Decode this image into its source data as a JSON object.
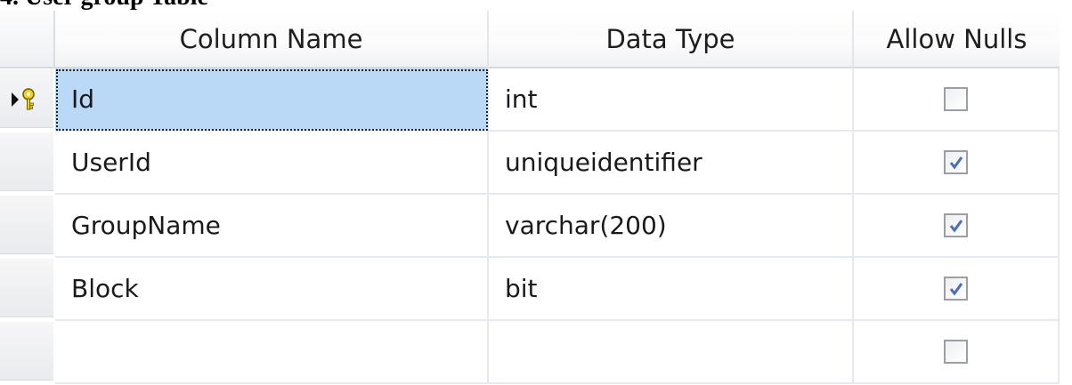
{
  "caption": "4. User group Table",
  "grid": {
    "headers": [
      "Column Name",
      "Data Type",
      "Allow Nulls"
    ],
    "rows": [
      {
        "column_name": "Id",
        "data_type": "int",
        "allow_nulls": false
      },
      {
        "column_name": "UserId",
        "data_type": "uniqueidentifier",
        "allow_nulls": true
      },
      {
        "column_name": "GroupName",
        "data_type": "varchar(200)",
        "allow_nulls": true
      },
      {
        "column_name": "Block",
        "data_type": "bit",
        "allow_nulls": true
      },
      {
        "column_name": "",
        "data_type": "",
        "allow_nulls": false
      }
    ]
  },
  "icons": {
    "current_row": "current-row-arrow-icon",
    "primary_key": "primary-key-icon"
  },
  "colors": {
    "selected_cell": "#b9d9f7",
    "check_mark": "#4a6fb3"
  }
}
